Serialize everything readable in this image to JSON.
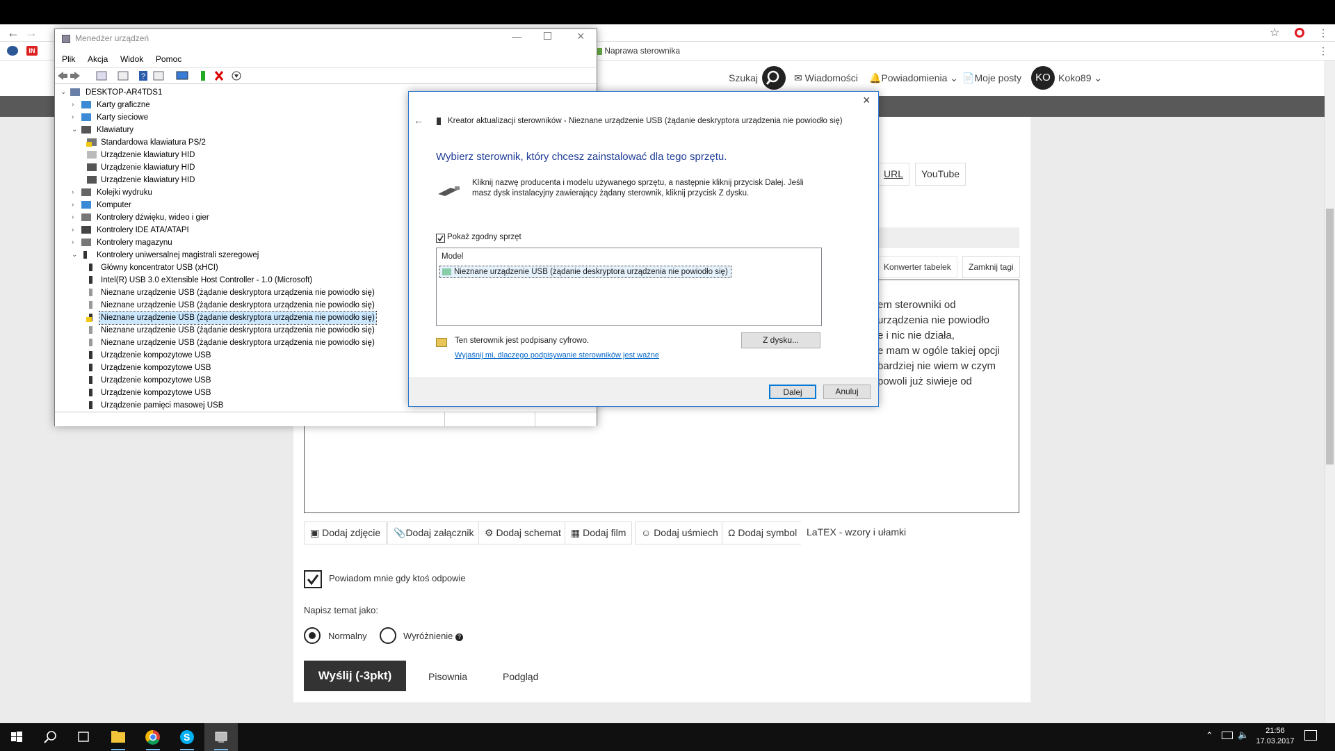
{
  "browser": {
    "tab_partial": "Naprawa sterownika",
    "bookmark_badge": "IN"
  },
  "site_header": {
    "search_label": "Szukaj",
    "messages": "Wiadomości",
    "notifications": "Powiadomienia",
    "my_posts": "Moje posty",
    "avatar_initials": "KO",
    "username": "Koko89"
  },
  "editor": {
    "url_btn": "URL",
    "youtube_btn": "YouTube",
    "convert_tables": "Konwerter tabelek",
    "close_tags": "Zamknij tagi",
    "body_lines": [
      "em sterowniki od",
      " urządzenia nie powiodło",
      "e i nic nie działa,",
      "e mam w ogóle takiej opcji",
      "bardziej nie wiem w czym",
      "powoli już siwieje od"
    ],
    "tools": [
      "Dodaj zdjęcie",
      "Dodaj załącznik",
      "Dodaj schemat",
      "Dodaj film",
      "Dodaj uśmiech",
      "Dodaj symbol",
      "LaTEX - wzory i ułamki"
    ]
  },
  "form": {
    "notify_label": "Powiadom mnie gdy ktoś odpowie",
    "write_as": "Napisz temat jako:",
    "opt_normal": "Normalny",
    "opt_highlight": "Wyróżnienie",
    "submit": "Wyślij (-3pkt)",
    "spelling": "Pisownia",
    "preview": "Podgląd"
  },
  "devmgr": {
    "title": "Menedżer urządzeń",
    "menu": [
      "Plik",
      "Akcja",
      "Widok",
      "Pomoc"
    ],
    "tree": [
      {
        "label": "DESKTOP-AR4TDS1",
        "level": 0,
        "exp": "v",
        "icon": "computer"
      },
      {
        "label": "Karty graficzne",
        "level": 1,
        "exp": ">",
        "icon": "display"
      },
      {
        "label": "Karty sieciowe",
        "level": 1,
        "exp": ">",
        "icon": "network"
      },
      {
        "label": "Klawiatury",
        "level": 1,
        "exp": "v",
        "icon": "keyboard"
      },
      {
        "label": "Standardowa klawiatura PS/2",
        "level": 2,
        "exp": "",
        "icon": "keyboard-warn"
      },
      {
        "label": "Urządzenie klawiatury HID",
        "level": 2,
        "exp": "",
        "icon": "keyboard-light"
      },
      {
        "label": "Urządzenie klawiatury HID",
        "level": 2,
        "exp": "",
        "icon": "keyboard"
      },
      {
        "label": "Urządzenie klawiatury HID",
        "level": 2,
        "exp": "",
        "icon": "keyboard"
      },
      {
        "label": "Kolejki wydruku",
        "level": 1,
        "exp": ">",
        "icon": "printer"
      },
      {
        "label": "Komputer",
        "level": 1,
        "exp": ">",
        "icon": "display"
      },
      {
        "label": "Kontrolery dźwięku, wideo i gier",
        "level": 1,
        "exp": ">",
        "icon": "speaker"
      },
      {
        "label": "Kontrolery IDE ATA/ATAPI",
        "level": 1,
        "exp": ">",
        "icon": "ide"
      },
      {
        "label": "Kontrolery magazynu",
        "level": 1,
        "exp": ">",
        "icon": "storage"
      },
      {
        "label": "Kontrolery uniwersalnej magistrali szeregowej",
        "level": 1,
        "exp": "v",
        "icon": "usb"
      },
      {
        "label": "Główny koncentrator USB (xHCI)",
        "level": 2,
        "exp": "",
        "icon": "usb"
      },
      {
        "label": "Intel(R) USB 3.0 eXtensible Host Controller - 1.0 (Microsoft)",
        "level": 2,
        "exp": "",
        "icon": "usb"
      },
      {
        "label": "Nieznane urządzenie USB (żądanie deskryptora urządzenia nie powiodło się)",
        "level": 2,
        "exp": "",
        "icon": "usb-light"
      },
      {
        "label": "Nieznane urządzenie USB (żądanie deskryptora urządzenia nie powiodło się)",
        "level": 2,
        "exp": "",
        "icon": "usb-light"
      },
      {
        "label": "Nieznane urządzenie USB (żądanie deskryptora urządzenia nie powiodło się)",
        "level": 2,
        "exp": "",
        "icon": "usb-warn",
        "selected": true
      },
      {
        "label": "Nieznane urządzenie USB (żądanie deskryptora urządzenia nie powiodło się)",
        "level": 2,
        "exp": "",
        "icon": "usb-light"
      },
      {
        "label": "Nieznane urządzenie USB (żądanie deskryptora urządzenia nie powiodło się)",
        "level": 2,
        "exp": "",
        "icon": "usb-light"
      },
      {
        "label": "Urządzenie kompozytowe USB",
        "level": 2,
        "exp": "",
        "icon": "usb"
      },
      {
        "label": "Urządzenie kompozytowe USB",
        "level": 2,
        "exp": "",
        "icon": "usb"
      },
      {
        "label": "Urządzenie kompozytowe USB",
        "level": 2,
        "exp": "",
        "icon": "usb"
      },
      {
        "label": "Urządzenie kompozytowe USB",
        "level": 2,
        "exp": "",
        "icon": "usb"
      },
      {
        "label": "Urządzenie pamięci masowej USB",
        "level": 2,
        "exp": "",
        "icon": "usb"
      }
    ]
  },
  "wizard": {
    "title": "Kreator aktualizacji sterowników - Nieznane urządzenie USB (żądanie deskryptora urządzenia nie powiodło się)",
    "heading": "Wybierz sterownik, który chcesz zainstalować dla tego sprzętu.",
    "desc_line1": "Kliknij nazwę producenta i modelu używanego sprzętu, a następnie kliknij przycisk Dalej. Jeśli",
    "desc_line2": "masz dysk instalacyjny zawierający żądany sterownik, kliknij przycisk Z dysku.",
    "show_compatible": "Pokaż zgodny sprzęt",
    "model_header": "Model",
    "model_item": "Nieznane urządzenie USB (żądanie deskryptora urządzenia nie powiodło się)",
    "signed_text": "Ten sterownik jest podpisany cyfrowo.",
    "signing_link": "Wyjaśnij mi, dlaczego podpisywanie sterowników jest ważne",
    "from_disk": "Z dysku...",
    "next": "Dalej",
    "cancel": "Anuluj"
  },
  "taskbar": {
    "time": "21:56",
    "date": "17.03.2017"
  },
  "colors": {
    "link_blue": "#0066cc",
    "heading_blue": "#1e3c96",
    "select_blue": "#cce8ff"
  }
}
